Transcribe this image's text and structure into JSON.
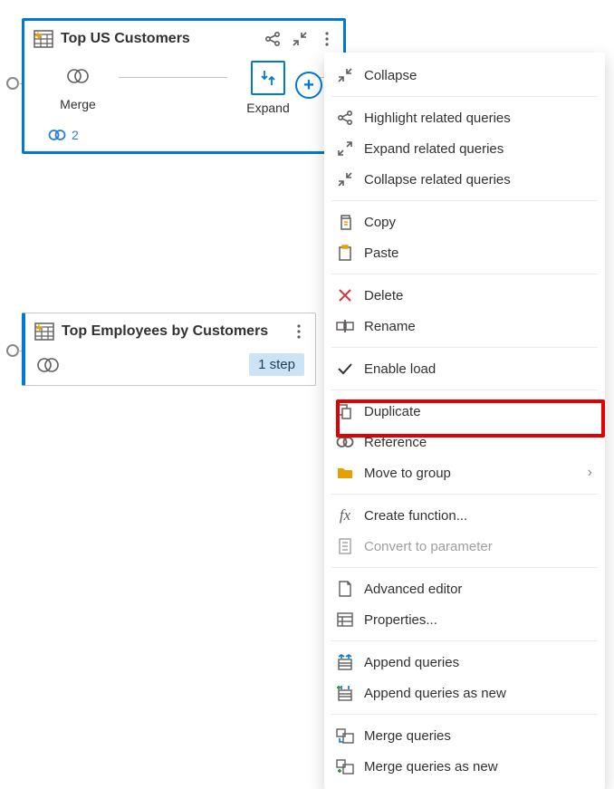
{
  "card1": {
    "title": "Top US Customers",
    "steps": [
      {
        "label": "Merge"
      },
      {
        "label": "Expand"
      }
    ],
    "linkCount": "2"
  },
  "card2": {
    "title": "Top Employees by Customers",
    "stepBadge": "1 step"
  },
  "menu": [
    "Collapse",
    "Highlight related queries",
    "Expand related queries",
    "Collapse related queries",
    "Copy",
    "Paste",
    "Delete",
    "Rename",
    "Enable load",
    "Duplicate",
    "Reference",
    "Move to group",
    "Create function...",
    "Convert to parameter",
    "Advanced editor",
    "Properties...",
    "Append queries",
    "Append queries as new",
    "Merge queries",
    "Merge queries as new"
  ]
}
